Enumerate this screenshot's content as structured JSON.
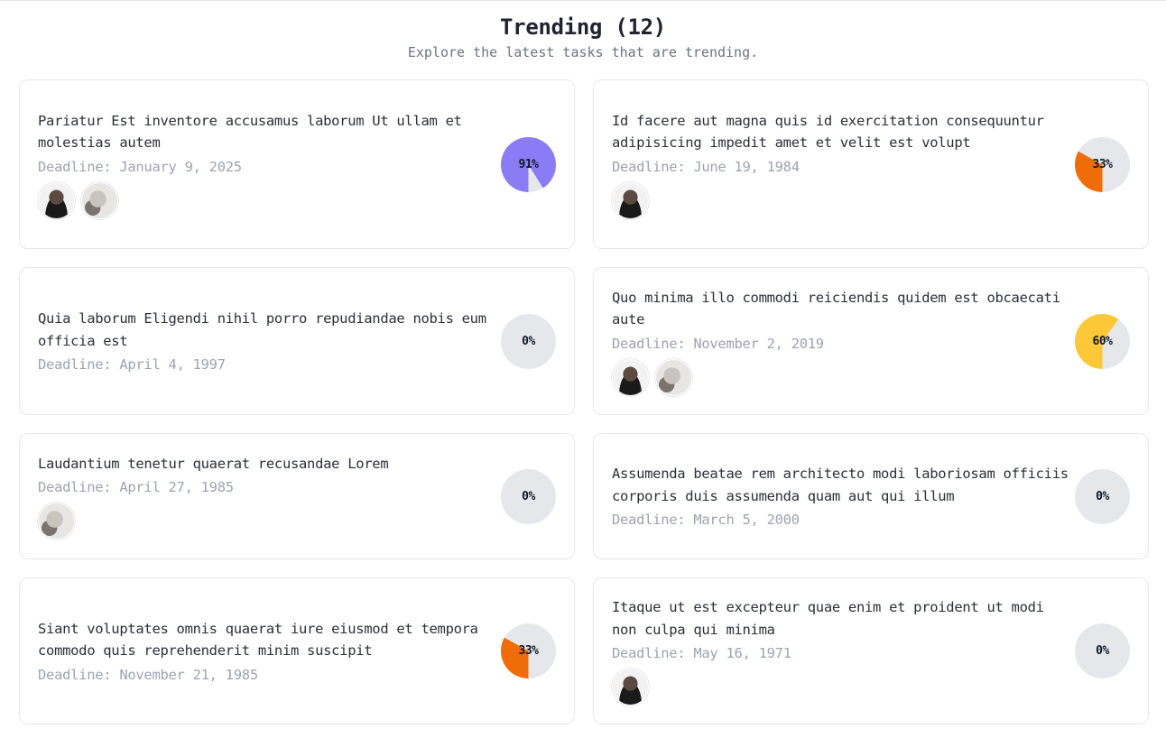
{
  "header": {
    "title": "Trending (12)",
    "subtitle": "Explore the latest tasks that are trending."
  },
  "colors": {
    "purple": "#8b7cf6",
    "orange": "#ef6c08",
    "yellow": "#fcc837",
    "track": "#e5e7eb"
  },
  "cards": [
    {
      "title": "Pariatur Est inventore accusamus laborum Ut ullam et molestias autem",
      "deadline": "Deadline: January 9, 2025",
      "progress_label": "91%",
      "progress": 0.91,
      "color": "#8b7cf6",
      "avatars": [
        "man",
        "cat"
      ]
    },
    {
      "title": "Id facere aut magna quis id exercitation consequuntur adipisicing impedit amet et velit est volupt",
      "deadline": "Deadline: June 19, 1984",
      "progress_label": "33%",
      "progress": 0.33,
      "color": "#ef6c08",
      "avatars": [
        "man"
      ]
    },
    {
      "title": "Quia laborum Eligendi nihil porro repudiandae nobis eum officia est",
      "deadline": "Deadline: April 4, 1997",
      "progress_label": "0%",
      "progress": 0,
      "color": "#e5e7eb",
      "avatars": []
    },
    {
      "title": "Quo minima illo commodi reiciendis quidem est obcaecati aute",
      "deadline": "Deadline: November 2, 2019",
      "progress_label": "60%",
      "progress": 0.6,
      "color": "#fcc837",
      "avatars": [
        "man",
        "cat"
      ]
    },
    {
      "title": "Laudantium tenetur quaerat recusandae Lorem",
      "deadline": "Deadline: April 27, 1985",
      "progress_label": "0%",
      "progress": 0,
      "color": "#e5e7eb",
      "avatars": [
        "cat"
      ]
    },
    {
      "title": "Assumenda beatae rem architecto modi laboriosam officiis corporis duis assumenda quam aut qui illum",
      "deadline": "Deadline: March 5, 2000",
      "progress_label": "0%",
      "progress": 0,
      "color": "#e5e7eb",
      "avatars": []
    },
    {
      "title": "Siant voluptates omnis quaerat iure eiusmod et tempora commodo quis reprehenderit minim suscipit",
      "deadline": "Deadline: November 21, 1985",
      "progress_label": "33%",
      "progress": 0.33,
      "color": "#ef6c08",
      "avatars": []
    },
    {
      "title": "Itaque ut est excepteur quae enim et proident ut modi non culpa qui minima",
      "deadline": "Deadline: May 16, 1971",
      "progress_label": "0%",
      "progress": 0,
      "color": "#e5e7eb",
      "avatars": [
        "man"
      ]
    }
  ]
}
